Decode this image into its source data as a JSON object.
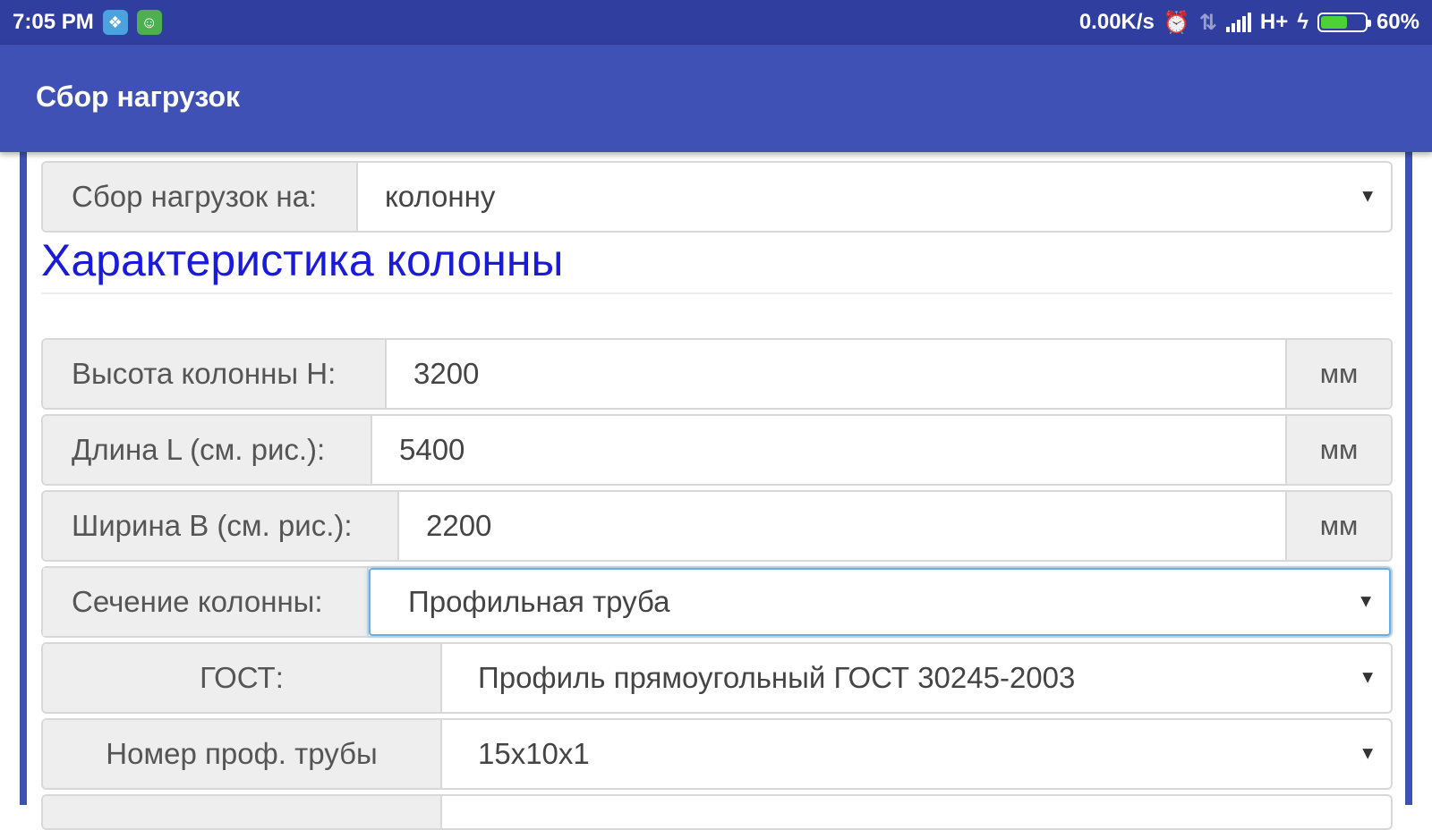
{
  "status_bar": {
    "time": "7:05 PM",
    "net_speed": "0.00K/s",
    "network_type": "H+",
    "battery": "60%",
    "battery_level": 0.6,
    "icons": [
      "app-notification-icon",
      "android-notification-icon",
      "alarm-icon",
      "data-transfer-icon",
      "signal-icon",
      "charging-icon",
      "battery-icon"
    ]
  },
  "app_bar": {
    "title": "Сбор нагрузок"
  },
  "load_target": {
    "label": "Сбор нагрузок на:",
    "value": "колонну"
  },
  "section": {
    "title": "Характеристика колонны"
  },
  "fields": {
    "height": {
      "label": "Высота колонны H:",
      "value": "3200",
      "unit": "мм"
    },
    "length": {
      "label": "Длина L (см. рис.):",
      "value": "5400",
      "unit": "мм"
    },
    "width": {
      "label": "Ширина B (см. рис.):",
      "value": "2200",
      "unit": "мм"
    },
    "section_type": {
      "label": "Сечение колонны:",
      "value": "Профильная труба"
    },
    "gost": {
      "label": "ГОСТ:",
      "value": "Профиль прямоугольный ГОСТ 30245-2003"
    },
    "pipe_number": {
      "label": "Номер проф. трубы",
      "value": "15x10x1"
    }
  },
  "colors": {
    "status_bar": "#303f9f",
    "app_bar": "#3f51b5",
    "section_title": "#1a1adb",
    "focus_border": "#66afe9"
  }
}
